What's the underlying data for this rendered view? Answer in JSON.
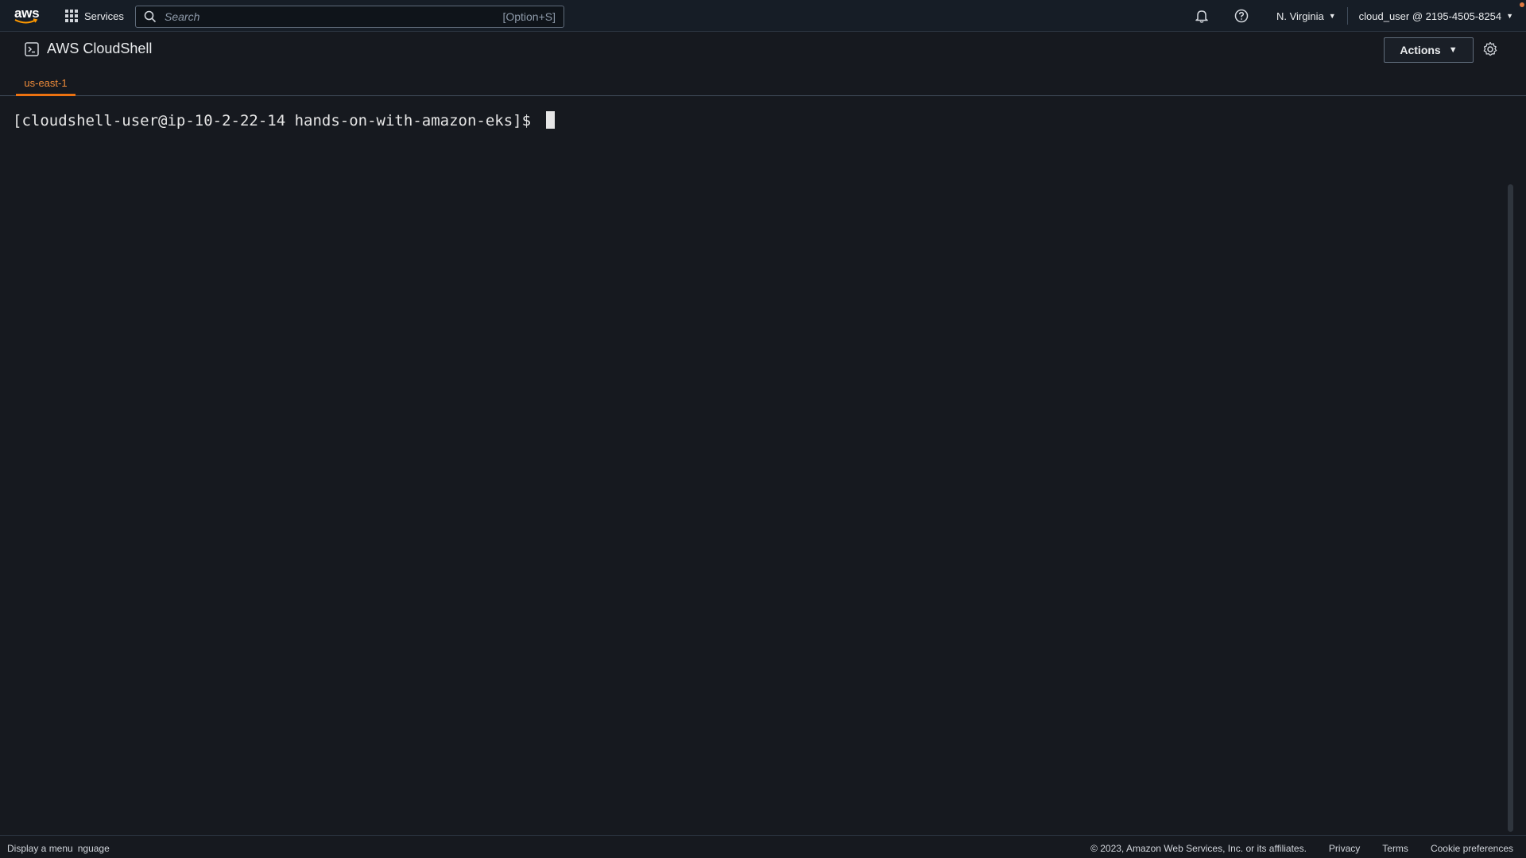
{
  "topnav": {
    "logo_text": "aws",
    "services_label": "Services",
    "search_placeholder": "Search",
    "search_shortcut": "[Option+S]",
    "region_label": "N. Virginia",
    "account_label": "cloud_user @ 2195-4505-8254",
    "icons": [
      "grid-icon",
      "search-icon",
      "bell-icon",
      "help-icon"
    ]
  },
  "header": {
    "title": "AWS CloudShell",
    "tab_label": "us-east-1",
    "actions_label": "Actions",
    "icons": [
      "terminal-icon",
      "gear-icon"
    ]
  },
  "terminal": {
    "prompt": "[cloudshell-user@ip-10-2-22-14 hands-on-with-amazon-eks]$ "
  },
  "footer": {
    "menu_label": "Display a menu",
    "language_label": "nguage",
    "copyright": "© 2023, Amazon Web Services, Inc. or its affiliates.",
    "privacy": "Privacy",
    "terms": "Terms",
    "cookie_preferences": "Cookie preferences"
  },
  "colors": {
    "accent": "#ec7211",
    "background": "#16191f",
    "nav_background": "#161d26"
  }
}
